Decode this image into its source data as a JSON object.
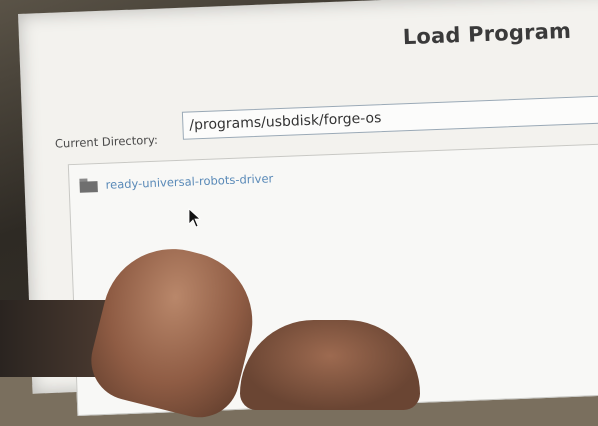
{
  "window": {
    "title": "Load Program"
  },
  "directory": {
    "label": "Current Directory:",
    "value": "/programs/usbdisk/forge-os"
  },
  "files": [
    {
      "name": "ready-universal-robots-driver",
      "icon": "folder-icon"
    }
  ],
  "colors": {
    "screen_bg": "#f3f2ee",
    "link_text": "#5a8ab8",
    "field_border": "#9aa9b6"
  }
}
